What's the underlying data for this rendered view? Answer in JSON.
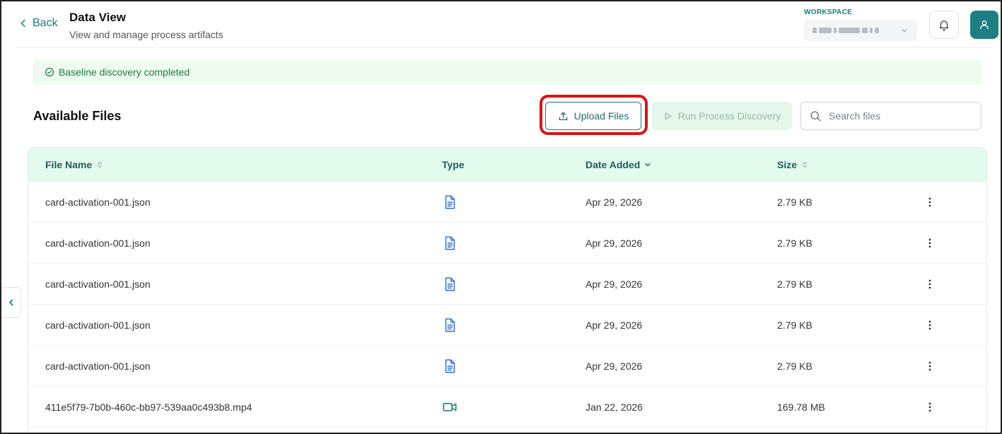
{
  "header": {
    "back_label": "Back",
    "title": "Data View",
    "subtitle": "View and manage process artifacts",
    "workspace_label": "WORKSPACE"
  },
  "banner": {
    "text": "Baseline discovery completed"
  },
  "toolbar": {
    "section_title": "Available Files",
    "upload_label": "Upload Files",
    "run_label": "Run Process Discovery",
    "search_placeholder": "Search files"
  },
  "table": {
    "columns": [
      "File Name",
      "Type",
      "Date Added",
      "Size"
    ],
    "rows": [
      {
        "name": "card-activation-001.json",
        "type": "document",
        "date": "Apr 29, 2026",
        "size": "2.79 KB"
      },
      {
        "name": "card-activation-001.json",
        "type": "document",
        "date": "Apr 29, 2026",
        "size": "2.79 KB"
      },
      {
        "name": "card-activation-001.json",
        "type": "document",
        "date": "Apr 29, 2026",
        "size": "2.79 KB"
      },
      {
        "name": "card-activation-001.json",
        "type": "document",
        "date": "Apr 29, 2026",
        "size": "2.79 KB"
      },
      {
        "name": "card-activation-001.json",
        "type": "document",
        "date": "Apr 29, 2026",
        "size": "2.79 KB"
      },
      {
        "name": "411e5f79-7b0b-460c-bb97-539aa0c493b8.mp4",
        "type": "video",
        "date": "Jan 22, 2026",
        "size": "169.78 MB"
      }
    ]
  },
  "icons": {
    "back": "chevron-left-icon",
    "notifications": "bell-icon",
    "user": "user-icon",
    "banner": "check-circle-icon",
    "upload": "upload-icon",
    "run": "play-icon",
    "search": "search-icon",
    "document": "document-icon",
    "video": "video-icon",
    "row_menu": "more-vertical-icon",
    "sidebar_toggle": "chevron-left-icon"
  },
  "colors": {
    "accent": "#1b7a7a",
    "avatar_bg": "#1d7f82",
    "banner_bg": "#eefbf1",
    "banner_text": "#217a3c",
    "table_header_bg": "#e3fbec",
    "highlight": "#d6141b",
    "doc_icon": "#2f6fe0",
    "video_icon": "#1b7a7a"
  }
}
